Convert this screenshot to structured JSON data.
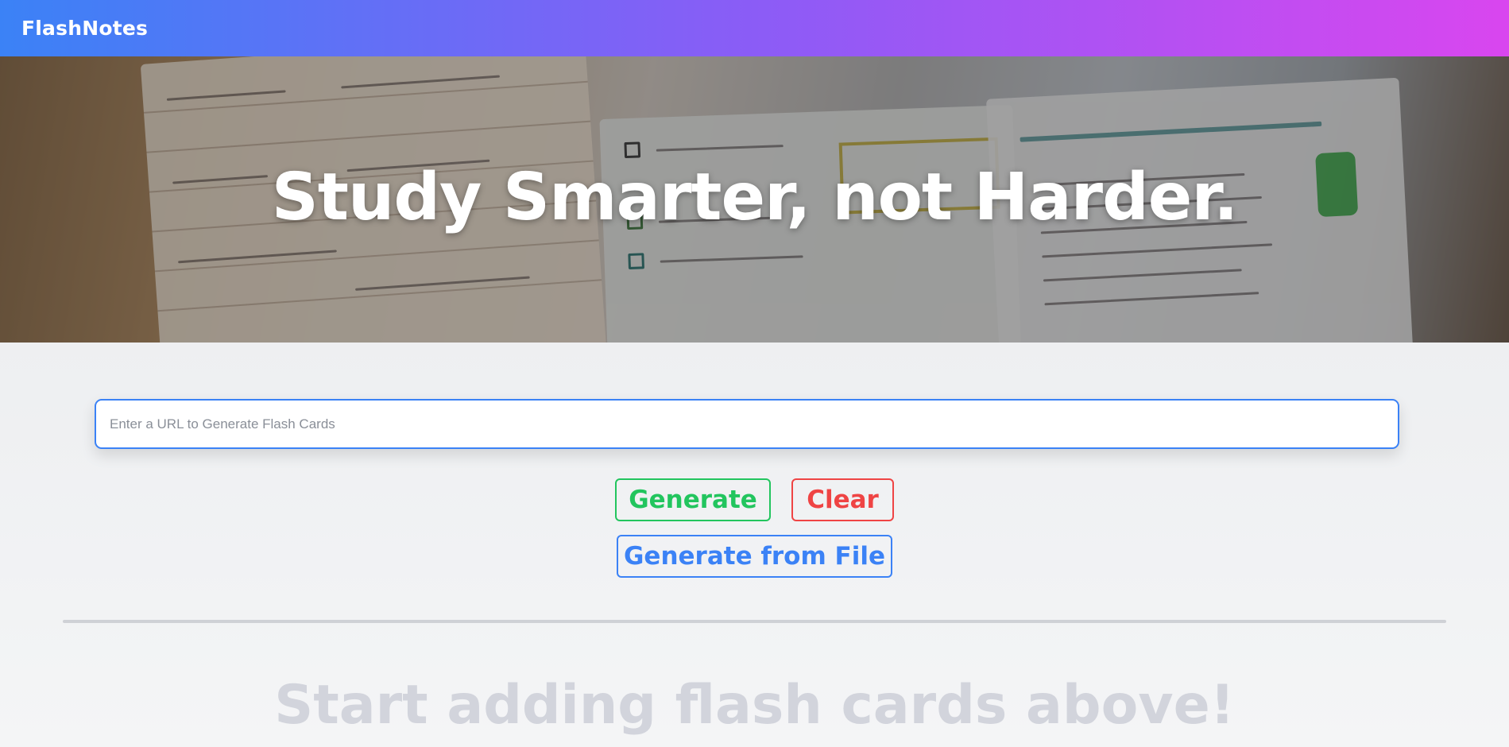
{
  "app": {
    "brand": "FlashNotes"
  },
  "hero": {
    "title": "Study Smarter, not Harder."
  },
  "input": {
    "placeholder": "Enter a URL to Generate Flash Cards",
    "value": ""
  },
  "buttons": {
    "generate": "Generate",
    "clear": "Clear",
    "generate_file": "Generate from File"
  },
  "empty_state": {
    "message": "Start adding flash cards above!"
  },
  "colors": {
    "nav_gradient_start": "#3b82f6",
    "nav_gradient_end": "#d946ef",
    "generate": "#22c55e",
    "clear": "#ef4444",
    "generate_file": "#3b82f6"
  }
}
